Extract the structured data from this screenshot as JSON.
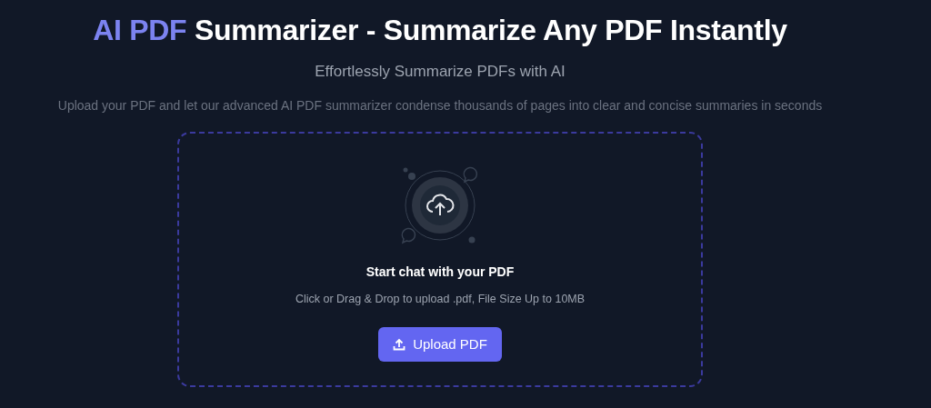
{
  "heading": {
    "highlight": "AI PDF",
    "text": "Summarizer - Summarize Any PDF Instantly"
  },
  "subtitle": "Effortlessly Summarize PDFs with AI",
  "description": "Upload your PDF and let our advanced AI PDF summarizer condense thousands of pages into clear and concise summaries in seconds",
  "dropzone": {
    "title": "Start chat with your PDF",
    "hint": "Click or Drag & Drop to upload .pdf, File Size Up to 10MB",
    "button": "Upload PDF"
  }
}
